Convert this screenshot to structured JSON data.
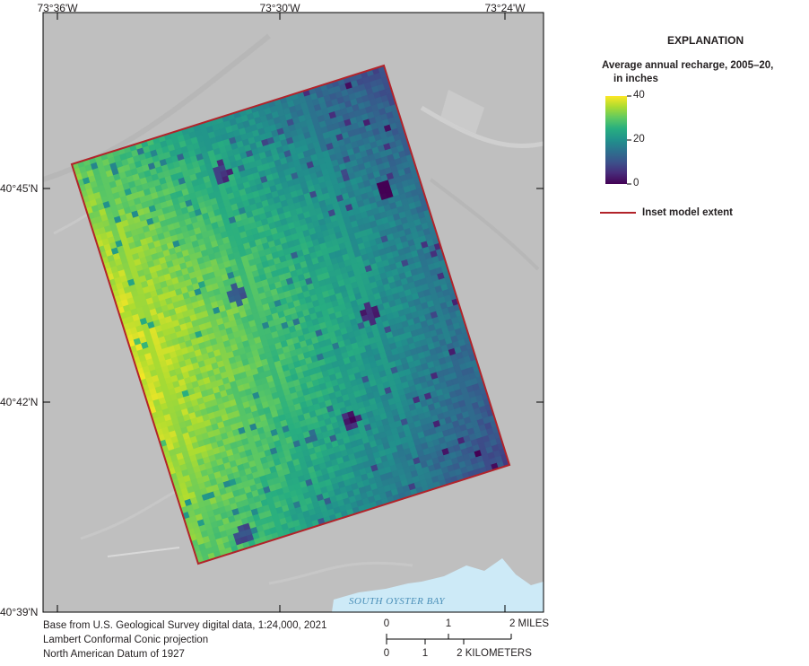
{
  "map": {
    "lon_labels": [
      "73°36'W",
      "73°30'W",
      "73°24'W"
    ],
    "lat_labels": [
      "40°45'N",
      "40°42'N",
      "40°39'N"
    ],
    "water_label": "SOUTH OYSTER BAY",
    "colors": {
      "hillshade": "#bfbfbf",
      "water": "#cdeaf7",
      "extent_line": "#b2232a",
      "neatline": "#000000"
    }
  },
  "credits": {
    "line1": "Base from U.S. Geological Survey digital data, 1:24,000, 2021",
    "line2": "Lambert Conformal Conic projection",
    "line3": "North American Datum of 1927"
  },
  "scale_bar": {
    "miles_labels": [
      "0",
      "1",
      "2 MILES"
    ],
    "km_labels": [
      "0",
      "1",
      "2 KILOMETERS"
    ]
  },
  "legend": {
    "title": "EXPLANATION",
    "colorbar_title_line1": "Average annual recharge, 2005–20,",
    "colorbar_title_line2": "in inches",
    "colorbar_ticks": [
      "40",
      "20",
      "0"
    ],
    "colorbar_range": [
      0,
      40
    ],
    "colormap": "viridis",
    "extent_label": "Inset model extent"
  }
}
